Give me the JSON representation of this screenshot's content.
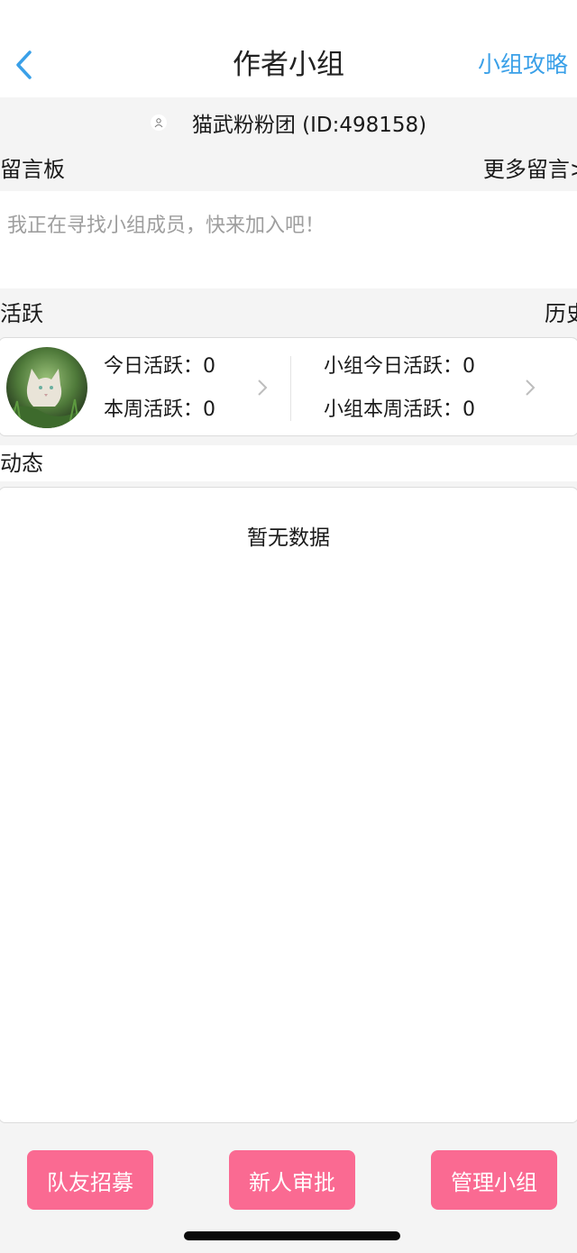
{
  "header": {
    "title": "作者小组",
    "guide_link": "小组攻略"
  },
  "group": {
    "name": "猫武粉粉团 (ID:498158)"
  },
  "message_board": {
    "label": "留言板",
    "more_link": "更多留言>",
    "placeholder_text": "我正在寻找小组成员，快来加入吧！"
  },
  "activity": {
    "label": "活跃",
    "history_link": "历史",
    "today_label": "今日活跃：",
    "today_value": "0",
    "week_label": "本周活跃：",
    "week_value": "0",
    "group_today_label": "小组今日活跃：",
    "group_today_value": "0",
    "group_week_label": "小组本周活跃：",
    "group_week_value": "0"
  },
  "feed": {
    "label": "动态",
    "empty_text": "暂无数据"
  },
  "actions": {
    "recruit": "队友招募",
    "approve": "新人审批",
    "manage": "管理小组"
  },
  "colors": {
    "accent": "#3aa0e8",
    "button": "#fa6a92"
  }
}
